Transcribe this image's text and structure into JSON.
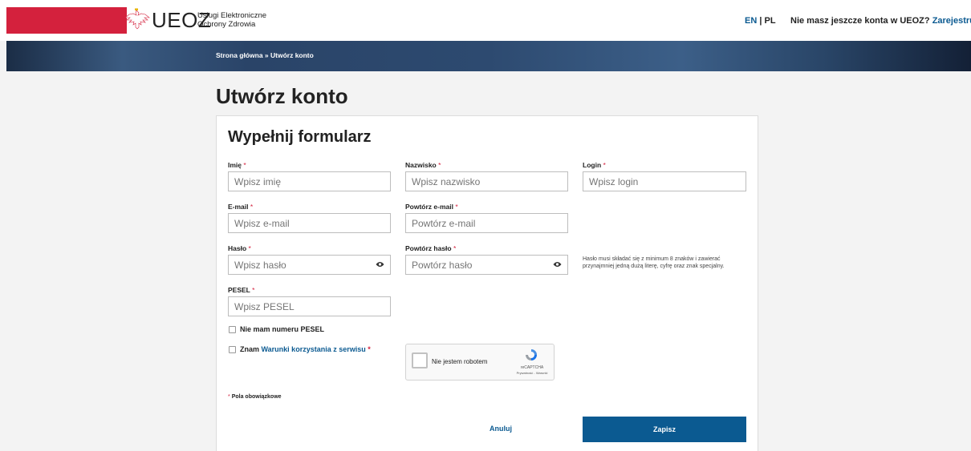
{
  "header": {
    "logo": "UEOZ",
    "logo_sub_line1": "Usługi Elektroniczne",
    "logo_sub_line2": "Ochrony Zdrowia",
    "lang_en": "EN",
    "lang_sep": " | ",
    "lang_pl": "PL",
    "account_prompt": "Nie masz jeszcze konta w UEOZ?",
    "register_link": "Zarejestruj się"
  },
  "breadcrumb": "Strona główna » Utwórz konto",
  "page_title": "Utwórz konto",
  "form": {
    "title": "Wypełnij formularz",
    "required_mark": "*",
    "fields": {
      "first_name": {
        "label": "Imię",
        "placeholder": "Wpisz imię"
      },
      "last_name": {
        "label": "Nazwisko",
        "placeholder": "Wpisz nazwisko"
      },
      "login": {
        "label": "Login",
        "placeholder": "Wpisz login"
      },
      "email": {
        "label": "E-mail",
        "placeholder": "Wpisz e-mail"
      },
      "email_repeat": {
        "label": "Powtórz e-mail",
        "placeholder": "Powtórz e-mail"
      },
      "password": {
        "label": "Hasło",
        "placeholder": "Wpisz hasło"
      },
      "password_repeat": {
        "label": "Powtórz hasło",
        "placeholder": "Powtórz hasło"
      },
      "pesel": {
        "label": "PESEL",
        "placeholder": "Wpisz PESEL"
      }
    },
    "password_hint": "Hasło musi składać się z minimum 8 znaków i zawierać przynajmniej jedną dużą literę, cyfrę oraz znak specjalny.",
    "no_pesel_label": "Nie mam numeru PESEL",
    "terms_prefix": "Znam ",
    "terms_link": "Warunki korzystania z serwisu",
    "recaptcha": {
      "label": "Nie jestem robotem",
      "brand": "reCAPTCHA",
      "links": "Prywatność - Warunki"
    },
    "required_note": "Pola obowiązkowe",
    "cancel_label": "Anuluj",
    "save_label": "Zapisz"
  }
}
